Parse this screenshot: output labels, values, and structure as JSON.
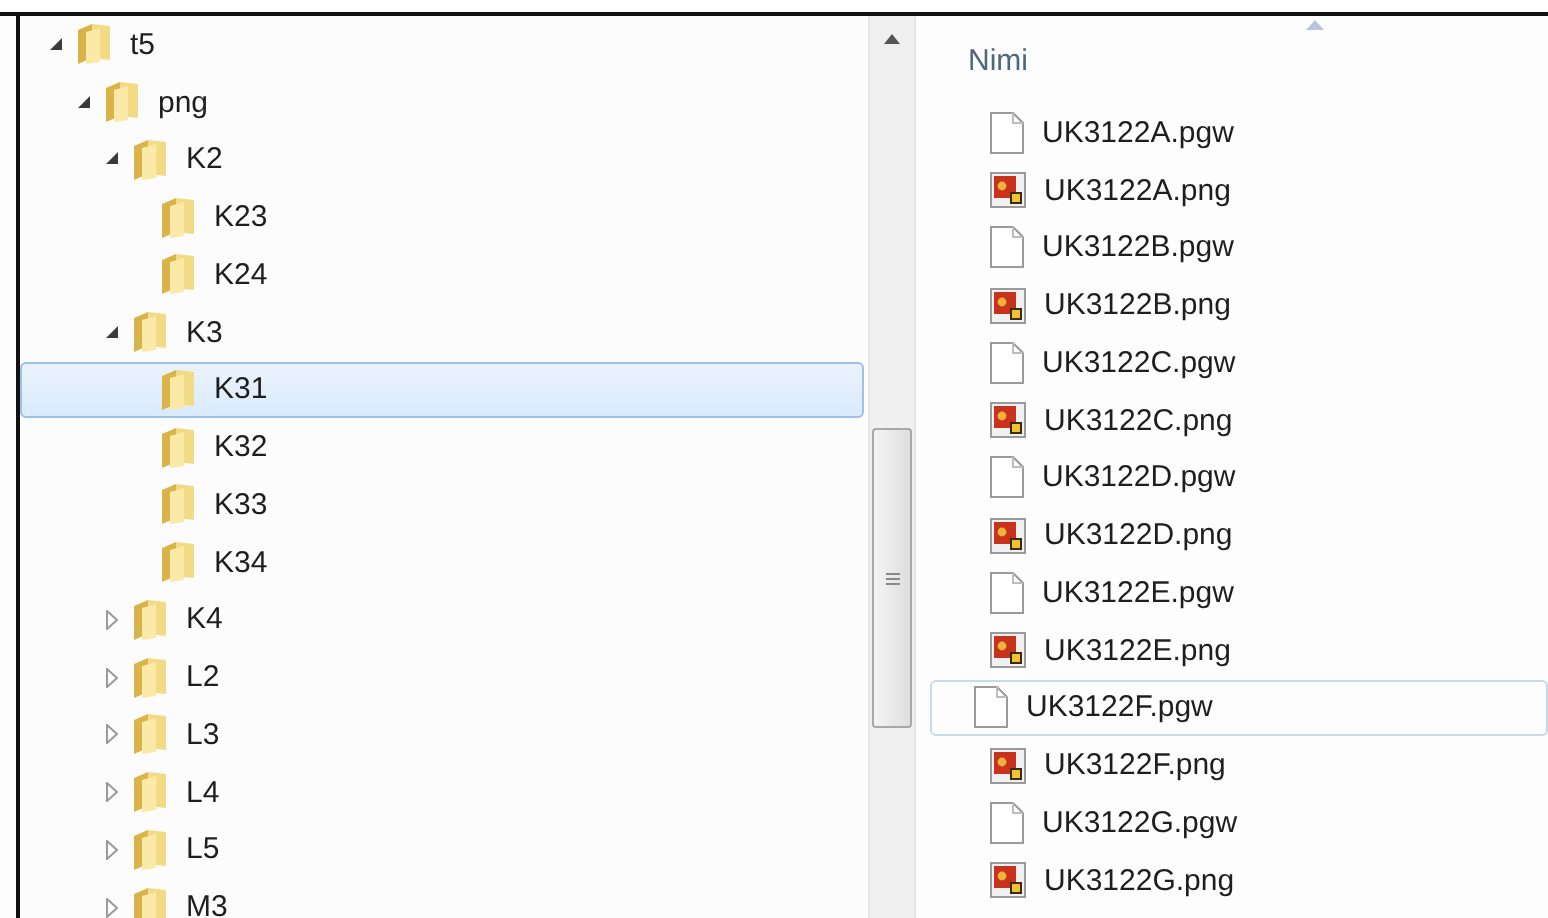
{
  "folder_tree": [
    {
      "label": "t5",
      "expanded": true,
      "selected": false,
      "children": [
        {
          "label": "png",
          "expanded": true,
          "selected": false,
          "children": [
            {
              "label": "K2",
              "expanded": true,
              "selected": false,
              "children": [
                {
                  "label": "K23",
                  "selected": false
                },
                {
                  "label": "K24",
                  "selected": false
                }
              ]
            },
            {
              "label": "K3",
              "expanded": true,
              "selected": false,
              "children": [
                {
                  "label": "K31",
                  "selected": true
                },
                {
                  "label": "K32",
                  "selected": false
                },
                {
                  "label": "K33",
                  "selected": false
                },
                {
                  "label": "K34",
                  "selected": false
                }
              ]
            },
            {
              "label": "K4",
              "expanded": false,
              "selected": false
            },
            {
              "label": "L2",
              "expanded": false,
              "selected": false
            },
            {
              "label": "L3",
              "expanded": false,
              "selected": false
            },
            {
              "label": "L4",
              "expanded": false,
              "selected": false
            },
            {
              "label": "L5",
              "expanded": false,
              "selected": false
            },
            {
              "label": "M3",
              "expanded": false,
              "selected": false
            }
          ]
        }
      ]
    }
  ],
  "file_list": {
    "column_header": "Nimi",
    "files": [
      {
        "name": "UK3122A.pgw",
        "kind": "document",
        "hovered": false
      },
      {
        "name": "UK3122A.png",
        "kind": "image",
        "hovered": false
      },
      {
        "name": "UK3122B.pgw",
        "kind": "document",
        "hovered": false
      },
      {
        "name": "UK3122B.png",
        "kind": "image",
        "hovered": false
      },
      {
        "name": "UK3122C.pgw",
        "kind": "document",
        "hovered": false
      },
      {
        "name": "UK3122C.png",
        "kind": "image",
        "hovered": false
      },
      {
        "name": "UK3122D.pgw",
        "kind": "document",
        "hovered": false
      },
      {
        "name": "UK3122D.png",
        "kind": "image",
        "hovered": false
      },
      {
        "name": "UK3122E.pgw",
        "kind": "document",
        "hovered": false
      },
      {
        "name": "UK3122E.png",
        "kind": "image",
        "hovered": false
      },
      {
        "name": "UK3122F.pgw",
        "kind": "document",
        "hovered": true
      },
      {
        "name": "UK3122F.png",
        "kind": "image",
        "hovered": false
      },
      {
        "name": "UK3122G.pgw",
        "kind": "document",
        "hovered": false
      },
      {
        "name": "UK3122G.png",
        "kind": "image",
        "hovered": false
      }
    ]
  }
}
